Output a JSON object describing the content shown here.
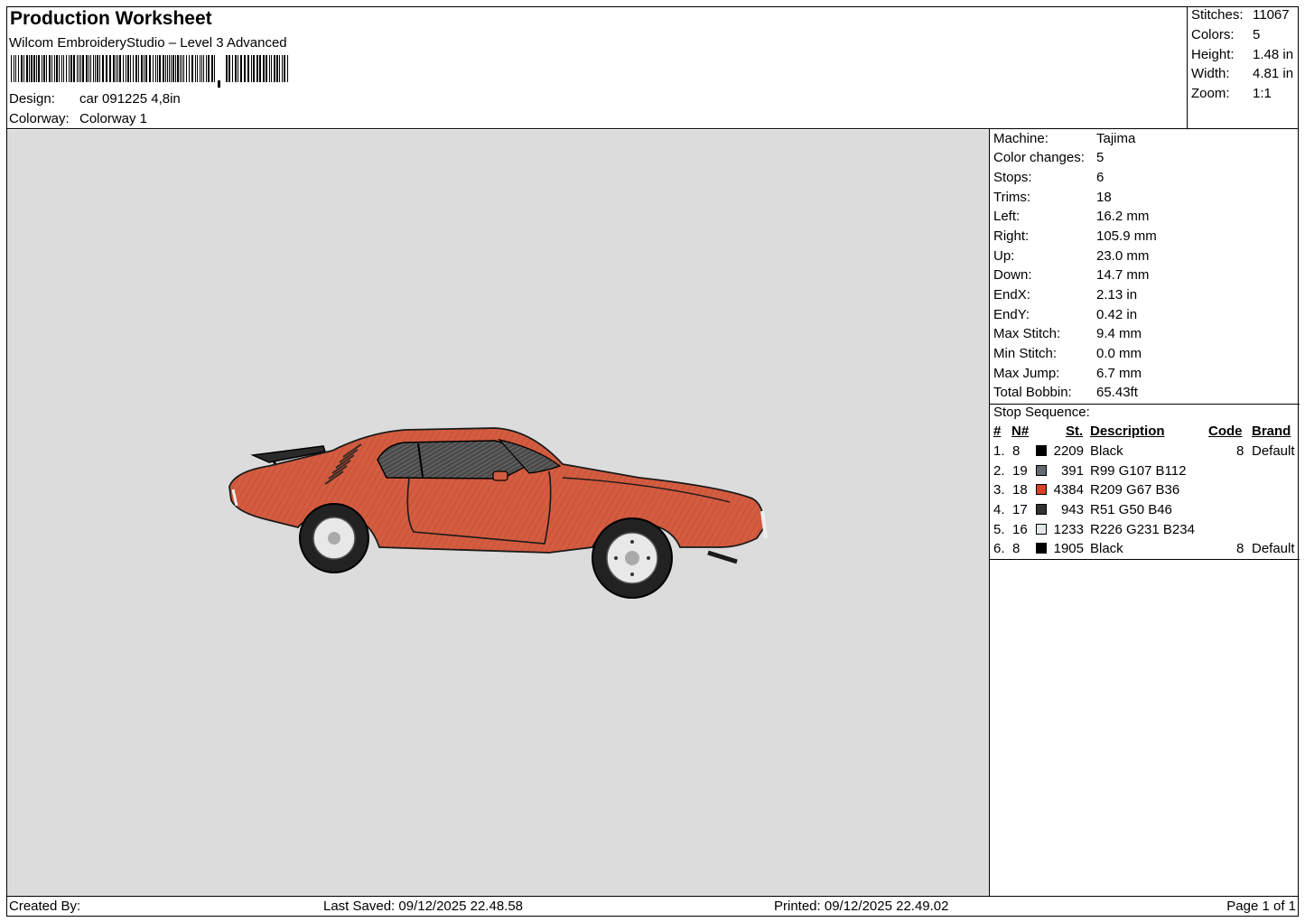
{
  "header": {
    "title": "Production Worksheet",
    "subtitle": "Wilcom EmbroideryStudio – Level 3 Advanced",
    "design_label": "Design:",
    "design_value": "car 091225 4,8in",
    "colorway_label": "Colorway:",
    "colorway_value": "Colorway 1"
  },
  "stats": [
    {
      "label": "Stitches:",
      "value": "11067"
    },
    {
      "label": "Colors:",
      "value": "5"
    },
    {
      "label": "Height:",
      "value": "1.48 in"
    },
    {
      "label": "Width:",
      "value": "4.81 in"
    },
    {
      "label": "Zoom:",
      "value": "1:1"
    }
  ],
  "machine": [
    {
      "label": "Machine:",
      "value": "Tajima"
    },
    {
      "label": "Color changes:",
      "value": "5"
    },
    {
      "label": "Stops:",
      "value": "6"
    },
    {
      "label": "Trims:",
      "value": "18"
    },
    {
      "label": "Left:",
      "value": "16.2 mm"
    },
    {
      "label": "Right:",
      "value": "105.9 mm"
    },
    {
      "label": "Up:",
      "value": "23.0 mm"
    },
    {
      "label": "Down:",
      "value": "14.7 mm"
    },
    {
      "label": "EndX:",
      "value": "2.13 in"
    },
    {
      "label": "EndY:",
      "value": "0.42 in"
    },
    {
      "label": "Max Stitch:",
      "value": "9.4 mm"
    },
    {
      "label": "Min Stitch:",
      "value": "0.0 mm"
    },
    {
      "label": "Max Jump:",
      "value": "6.7 mm"
    },
    {
      "label": "Total Bobbin:",
      "value": "65.43ft"
    }
  ],
  "stop_sequence": {
    "title": "Stop Sequence:",
    "headers": {
      "num": "#",
      "needle": "N#",
      "stitches": "St.",
      "description": "Description",
      "code": "Code",
      "brand": "Brand"
    },
    "rows": [
      {
        "num": "1.",
        "needle": "8",
        "color": "#000000",
        "stitches": "2209",
        "description": "Black",
        "code": "8",
        "brand": "Default"
      },
      {
        "num": "2.",
        "needle": "19",
        "color": "#636b70",
        "stitches": "391",
        "description": "R99 G107 B112",
        "code": "",
        "brand": ""
      },
      {
        "num": "3.",
        "needle": "18",
        "color": "#d14324",
        "stitches": "4384",
        "description": "R209 G67 B36",
        "code": "",
        "brand": ""
      },
      {
        "num": "4.",
        "needle": "17",
        "color": "#33322e",
        "stitches": "943",
        "description": "R51 G50 B46",
        "code": "",
        "brand": ""
      },
      {
        "num": "5.",
        "needle": "16",
        "color": "#e2e7ea",
        "stitches": "1233",
        "description": "R226 G231 B234",
        "code": "",
        "brand": ""
      },
      {
        "num": "6.",
        "needle": "8",
        "color": "#000000",
        "stitches": "1905",
        "description": "Black",
        "code": "8",
        "brand": "Default"
      }
    ]
  },
  "footer": {
    "created_by": "Created By:",
    "last_saved": "Last Saved: 09/12/2025 22.48.58",
    "printed": "Printed: 09/12/2025 22.49.02",
    "page": "Page 1 of 1"
  },
  "colors": {
    "canvas_bg": "#dcdcdc",
    "car_body": "#d45c40"
  }
}
